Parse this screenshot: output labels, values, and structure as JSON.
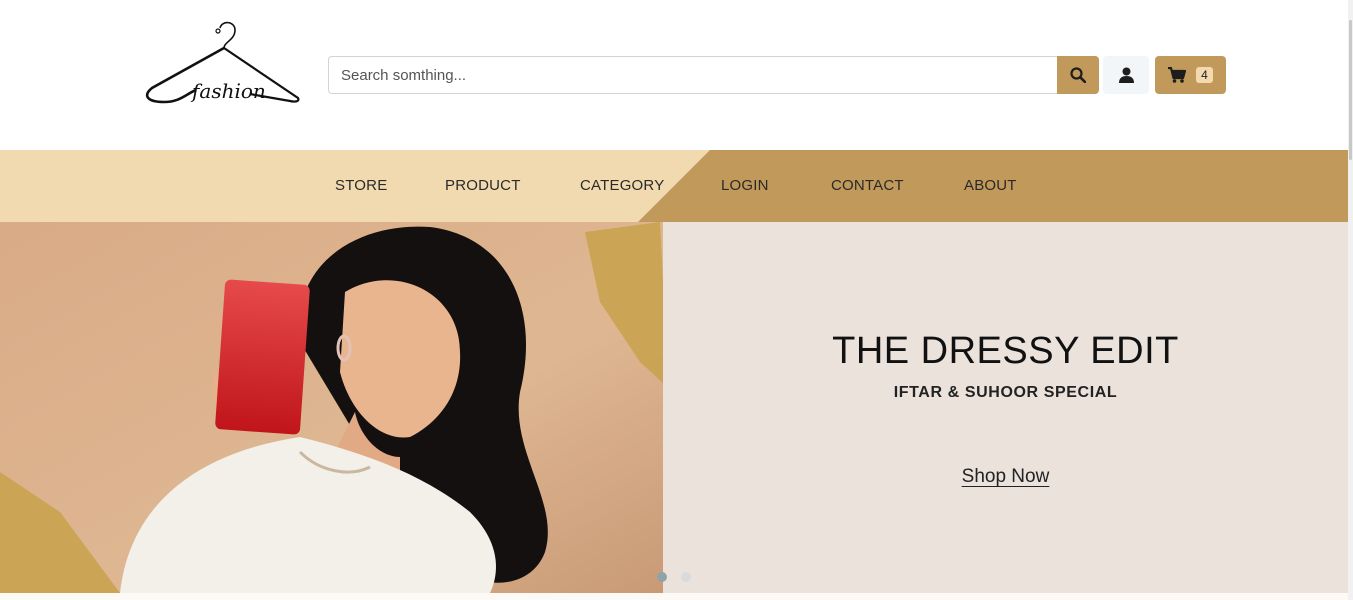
{
  "header": {
    "logo_text": "fashion",
    "search": {
      "placeholder": "Search somthing...",
      "value": ""
    },
    "cart": {
      "count": "4"
    }
  },
  "nav": {
    "items": [
      {
        "label": "STORE"
      },
      {
        "label": "PRODUCT"
      },
      {
        "label": "CATEGORY"
      },
      {
        "label": "LOGIN"
      },
      {
        "label": "CONTACT"
      },
      {
        "label": "ABOUT"
      }
    ]
  },
  "hero": {
    "title": "THE DRESSY EDIT",
    "subtitle": "IFTAR & SUHOOR SPECIAL",
    "cta": "Shop Now",
    "slides": {
      "count": 2,
      "active": 1
    }
  },
  "icons": {
    "search": "search-icon",
    "user": "user-icon",
    "cart": "cart-icon"
  },
  "colors": {
    "accent": "#c1995a",
    "nav_light": "#f1dab0",
    "hero_bg": "#ebe2dc"
  }
}
